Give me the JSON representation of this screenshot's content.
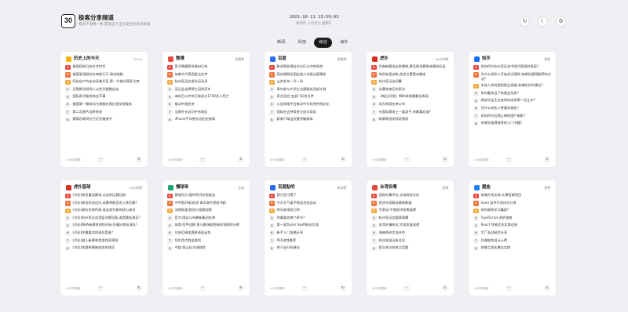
{
  "header": {
    "logo_text": "30",
    "title": "极客分享频道",
    "subtitle": "每天不浪费一秒,获取当下正在发生的热点新闻",
    "clock": "2023-10-11 13:59:03",
    "lunar": "癸卯年 八月廿七 星期三",
    "refresh_icon": "↻",
    "theme_icon": "☾",
    "settings_icon": "⚙"
  },
  "tabs": [
    {
      "label": "新闻",
      "active": false
    },
    {
      "label": "科技",
      "active": false
    },
    {
      "label": "综合",
      "active": true
    },
    {
      "label": "海外",
      "active": false
    }
  ],
  "colors": {
    "rank1": "#e8493f",
    "rank2": "#f0743c",
    "rank3": "#f2a93b"
  },
  "cards": [
    {
      "name": "历史上的今天",
      "tag": "10-11",
      "icon_color": "#f5b400",
      "footer": "4小时前更新",
      "items": [
        "美国民航开启文字时代",
        "美国驱逐舰在东南航行马·瑞克纳路",
        "阿拉伯产的走向亚美尼亚·第一代首任国家主席",
        "巴勒斯坦领导人以色列首脑会谈",
        "国际原子能机构总干事",
        "美国第一艘核动力潜艇在两位里发射服务",
        "第二次鸦片战争结束",
        "赛福尔斯阿尔巴尼亚撤退中"
      ]
    },
    {
      "name": "微博",
      "tag": "热搜榜",
      "icon_color": "#e8493f",
      "footer": "4小时前更新",
      "items": [
        "男子偶遇男孩骑自行车",
        "加拿大代表团抵达北京",
        "杭州亚运会游泳运动员",
        "亚运会金牌得主回到家乡",
        "本轮巴以冲突已致双方1700多人死亡",
        "推动中国经济",
        "法国外长访问中东地区",
        "iPhone平均售价创历史新高"
      ]
    },
    {
      "name": "百度",
      "tag": "热搜榜",
      "icon_color": "#2f6bf0",
      "footer": "4小时前更新",
      "items": [
        "联合国安理会讨论巴以冲突局势",
        "国庆假期全国出游人次超过疫情前",
        "山东发布一号一码",
        "青年参与大学生志愿服务西部计划",
        "官方回应:五部门印发文件",
        "公告网络平台推动中华优秀传统文化",
        "国际社会持续关注加沙局势",
        "蔚来汽车出货量突破新高"
      ]
    },
    {
      "name": "虎扑",
      "tag": "24小时榜",
      "icon_color": "#d8301f",
      "footer": "4小时前更新",
      "items": [
        "阿森纳客场击败曼城,赛后球员赛季成绩创纪录",
        "球员恢复训练,首发位置暂未确定",
        "杭州亚运会闭幕",
        "比赛结束后的采访",
        "【每日问答】NBA季前赛最佳表现",
        "双方阵容名单公布",
        "在国际赛场上一展身手,你最喜欢谁?",
        "新赛季首发阵容预测"
      ]
    },
    {
      "name": "知乎",
      "tag": "热榜",
      "icon_color": "#1772f6",
      "footer": "4小时前更新",
      "items": [
        "如何评价杭州亚运会中国代表团的表现?",
        "为什么很多人开始关注理财,有哪些值得推荐的方法?",
        "年轻人如何规划职业发展,有哪些好的建议?",
        "如何看待当下的就业形势?",
        "高校毕业生应该如何选择第一份工作?",
        "为什么有些人更喜欢独处?",
        "如何评价近期上映的国产电影?",
        "有哪些值得推荐的入门书籍?"
      ]
    },
    {
      "name": "虎扑篮球",
      "tag": "24小时榜",
      "icon_color": "#d8301f",
      "footer": "4小时前更新",
      "items": [
        "[讨论]球员重返赛场,过去的比赛回顾",
        "[讨论]球员状态回升,本赛季能否进入季后赛?",
        "[讨论]球队交易传闻,谁会成为新的核心球员",
        "[讨论]杭州亚运会男篮决赛回顾,谁是最佳球员?",
        "[讨论]NBA新赛季即将开始,你看好哪支球队?",
        "[讨论]你最喜欢的球员是谁?",
        "[讨论]湖人新赛季首发阵容预测",
        "[讨论]本赛季最被低估的球员"
      ]
    },
    {
      "name": "懂球帝",
      "tag": "头条",
      "icon_color": "#13a86b",
      "footer": "4小时前更新",
      "items": [
        "曼城官方:德布劳内伤愈复出",
        "中甲第29轮综述:青岛海牛提前冲超",
        "深夜报道:欧冠小组赛战报",
        "官方:国足公布最新集训名单",
        "体育·西甲战报:皇马客场取胜继续领跑积分榜",
        "贝林厄姆本赛季表现出色",
        "切尔西大胜伯恩利",
        "中超:泰山队主场取胜"
      ]
    },
    {
      "name": "百度贴吧",
      "tag": "热议榜",
      "icon_color": "#2f6bf0",
      "footer": "4小时前更新",
      "items": [
        "我已经习惯了",
        "今天天气真不错适合出去玩",
        "明天继续努力吧",
        "你最喜欢哪个季节?",
        "第一届Taylor Swift粉丝交流",
        "新手入门攻略分享",
        "PS5游戏推荐",
        "关于出行的建议"
      ]
    },
    {
      "name": "台湾名嘴",
      "tag": "热榜",
      "icon_color": "#e8493f",
      "footer": "4小时前更新",
      "items": [
        "国际时事评论:全球局势分析",
        "经济学家解读最新数据",
        "专家谈:中国经济前景展望",
        "杭州亚运会圆满落幕",
        "台湾名嘴热议:大陆发展成就",
        "海峡两岸交流合作",
        "科技发展日新月异",
        "民众关注的热点话题"
      ]
    },
    {
      "name": "掘金",
      "tag": "热榜",
      "icon_color": "#1e80ff",
      "footer": "4小时前更新",
      "items": [
        "前端开发实践:从零搭建项目",
        "Vue3 组件开发技巧分享",
        "如何高效学习编程?",
        "TypeScript 进阶指南",
        "React 性能优化实践总结",
        "大厂面试经验分享",
        "后端架构设计心得",
        "前端工程化最佳实践"
      ]
    }
  ]
}
